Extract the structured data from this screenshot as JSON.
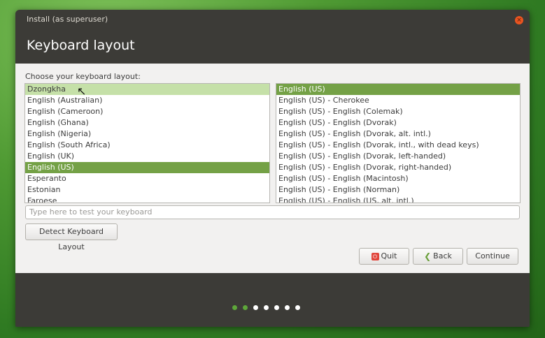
{
  "window": {
    "title": "Install (as superuser)",
    "close_glyph": "×"
  },
  "header": {
    "title": "Keyboard layout"
  },
  "content": {
    "choose_label": "Choose your keyboard layout:"
  },
  "layouts": {
    "items": [
      "Dzongkha",
      "English (Australian)",
      "English (Cameroon)",
      "English (Ghana)",
      "English (Nigeria)",
      "English (South Africa)",
      "English (UK)",
      "English (US)",
      "Esperanto",
      "Estonian",
      "Faroese"
    ],
    "selected": "English (US)",
    "hovered": "Dzongkha"
  },
  "variants": {
    "items": [
      "English (US)",
      "English (US) - Cherokee",
      "English (US) - English (Colemak)",
      "English (US) - English (Dvorak)",
      "English (US) - English (Dvorak, alt. intl.)",
      "English (US) - English (Dvorak, intl., with dead keys)",
      "English (US) - English (Dvorak, left-handed)",
      "English (US) - English (Dvorak, right-handed)",
      "English (US) - English (Macintosh)",
      "English (US) - English (Norman)",
      "English (US) - English (US, alt. intl.)"
    ],
    "selected": "English (US)"
  },
  "test_input": {
    "placeholder": "Type here to test your keyboard"
  },
  "buttons": {
    "detect": "Detect Keyboard Layout",
    "quit": "Quit",
    "back": "Back",
    "continue": "Continue"
  },
  "icons": {
    "quit": "power-icon",
    "back": "chevron-left-icon",
    "cursor": "mouse-pointer-icon"
  },
  "colors": {
    "accent": "#74a146",
    "hover": "#c5e0a8",
    "close": "#e95420",
    "dot_active": "#5ea73a"
  },
  "progress": {
    "total_steps": 7,
    "completed_steps": 2
  }
}
